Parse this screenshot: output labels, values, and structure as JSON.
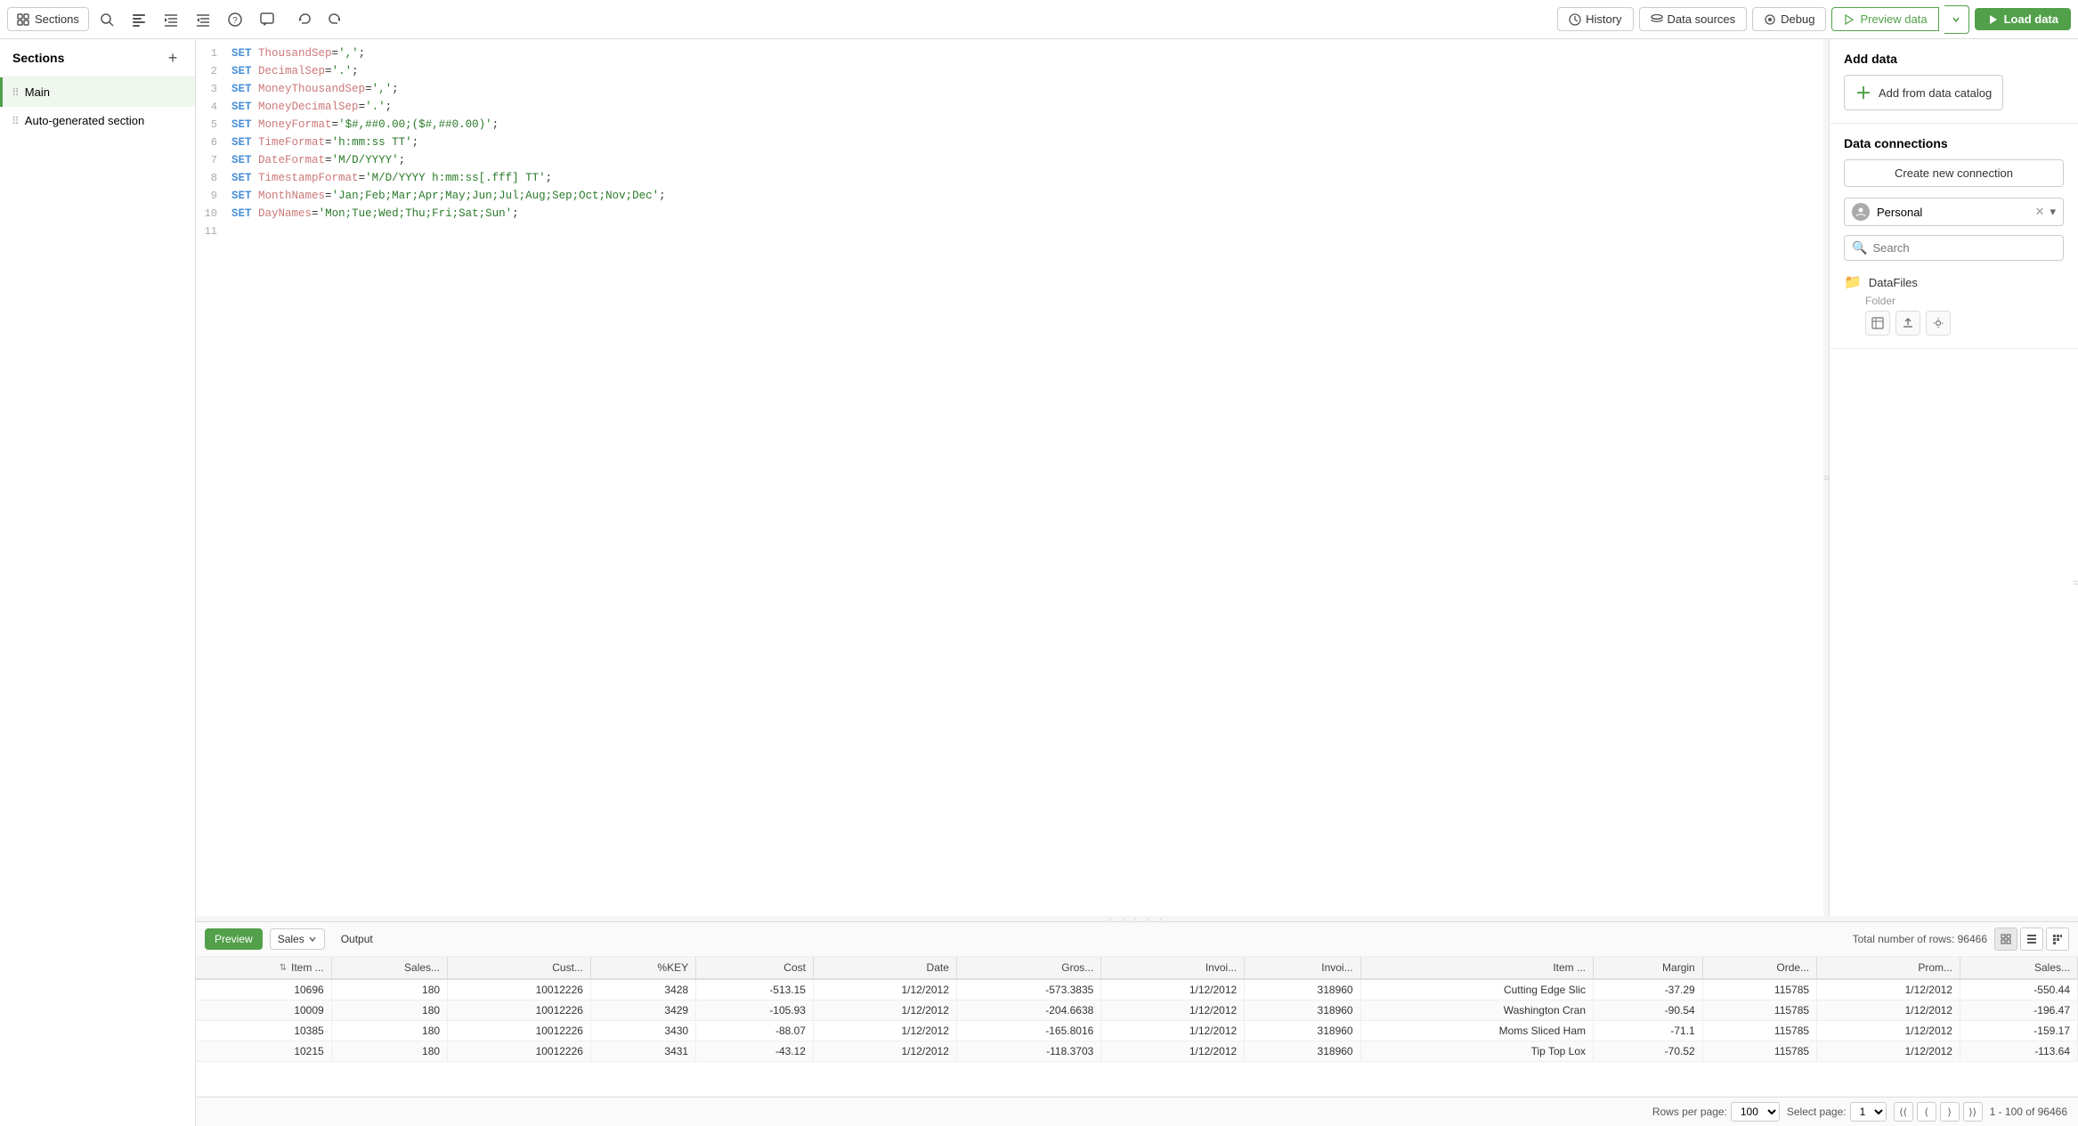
{
  "toolbar": {
    "sections_label": "Sections",
    "history_label": "History",
    "datasources_label": "Data sources",
    "debug_label": "Debug",
    "preview_label": "Preview data",
    "load_label": "Load data"
  },
  "sidebar": {
    "title": "Sections",
    "add_tooltip": "+",
    "items": [
      {
        "label": "Main",
        "active": true
      },
      {
        "label": "Auto-generated section",
        "active": false
      }
    ]
  },
  "editor": {
    "lines": [
      {
        "num": "1",
        "content": "SET ThousandSep=',';"
      },
      {
        "num": "2",
        "content": "SET DecimalSep='.';"
      },
      {
        "num": "3",
        "content": "SET MoneyThousandSep=',';"
      },
      {
        "num": "4",
        "content": "SET MoneyDecimalSep='.';"
      },
      {
        "num": "5",
        "content": "SET MoneyFormat='$#,##0.00;($#,##0.00)';"
      },
      {
        "num": "6",
        "content": "SET TimeFormat='h:mm:ss TT';"
      },
      {
        "num": "7",
        "content": "SET DateFormat='M/D/YYYY';"
      },
      {
        "num": "8",
        "content": "SET TimestampFormat='M/D/YYYY h:mm:ss[.fff] TT';"
      },
      {
        "num": "9",
        "content": "SET MonthNames='Jan;Feb;Mar;Apr;May;Jun;Jul;Aug;Sep;Oct;Nov;Dec';"
      },
      {
        "num": "10",
        "content": "SET DayNames='Mon;Tue;Wed;Thu;Fri;Sat;Sun';"
      },
      {
        "num": "11",
        "content": ""
      }
    ]
  },
  "right_panel": {
    "add_data_title": "Add data",
    "add_catalog_label": "Add from data catalog",
    "data_connections_title": "Data connections",
    "create_connection_label": "Create new connection",
    "personal_label": "Personal",
    "search_placeholder": "Search",
    "datafiles_label": "DataFiles",
    "folder_label": "Folder"
  },
  "preview": {
    "tab_preview": "Preview",
    "tab_output": "Output",
    "table_select": "Sales",
    "total_rows_label": "Total number of rows: 96466",
    "columns": [
      {
        "header": "Item ...",
        "sort": true
      },
      {
        "header": "Sales...",
        "sort": false
      },
      {
        "header": "Cust...",
        "sort": false
      },
      {
        "header": "%KEY",
        "sort": false
      },
      {
        "header": "Cost",
        "sort": false
      },
      {
        "header": "Date",
        "sort": false
      },
      {
        "header": "Gros...",
        "sort": false
      },
      {
        "header": "Invoi...",
        "sort": false
      },
      {
        "header": "Invoi...",
        "sort": false
      },
      {
        "header": "Item ...",
        "sort": false
      },
      {
        "header": "Margin",
        "sort": false
      },
      {
        "header": "Orde...",
        "sort": false
      },
      {
        "header": "Prom...",
        "sort": false
      },
      {
        "header": "Sales...",
        "sort": false
      }
    ],
    "rows": [
      [
        "10696",
        "180",
        "10012226",
        "3428",
        "-513.15",
        "1/12/2012",
        "-573.3835",
        "1/12/2012",
        "318960",
        "Cutting Edge Slic",
        "-37.29",
        "115785",
        "1/12/2012",
        "-550.44"
      ],
      [
        "10009",
        "180",
        "10012226",
        "3429",
        "-105.93",
        "1/12/2012",
        "-204.6638",
        "1/12/2012",
        "318960",
        "Washington Cran",
        "-90.54",
        "115785",
        "1/12/2012",
        "-196.47"
      ],
      [
        "10385",
        "180",
        "10012226",
        "3430",
        "-88.07",
        "1/12/2012",
        "-165.8016",
        "1/12/2012",
        "318960",
        "Moms Sliced Ham",
        "-71.1",
        "115785",
        "1/12/2012",
        "-159.17"
      ],
      [
        "10215",
        "180",
        "10012226",
        "3431",
        "-43.12",
        "1/12/2012",
        "-118.3703",
        "1/12/2012",
        "318960",
        "Tip Top Lox",
        "-70.52",
        "115785",
        "1/12/2012",
        "-113.64"
      ]
    ]
  },
  "pagination": {
    "rows_per_page_label": "Rows per page:",
    "rows_per_page_value": "100",
    "select_page_label": "Select page:",
    "page_value": "1",
    "range_label": "1 - 100 of 96466"
  }
}
